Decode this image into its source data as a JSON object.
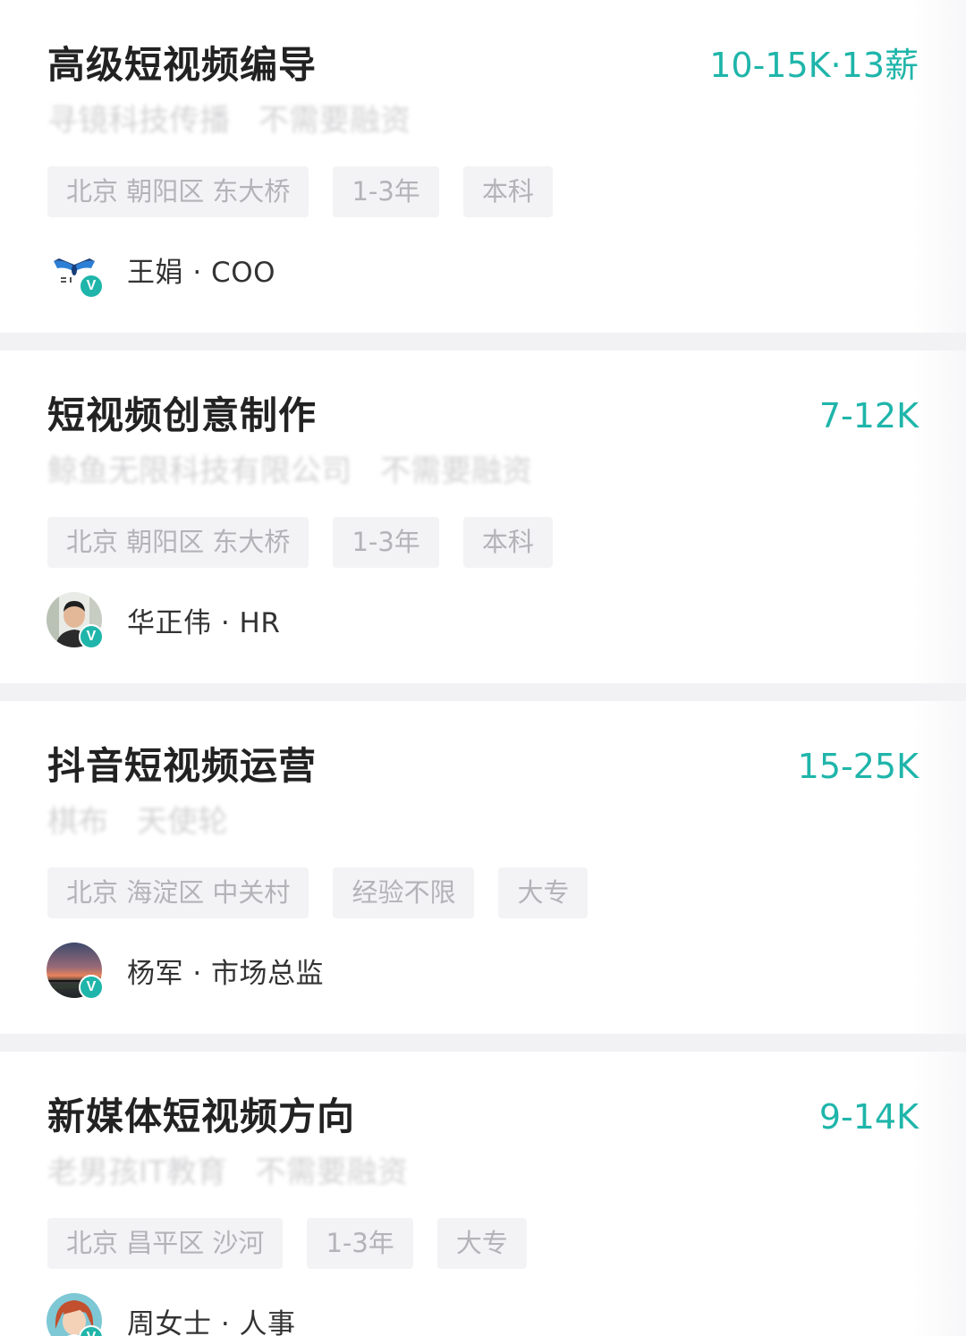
{
  "jobs": [
    {
      "title": "高级短视频编导",
      "salary": "10-15K·13薪",
      "company": "寻镜科技传播",
      "funding": "不需要融资",
      "tags": [
        "北京 朝阳区 东大桥",
        "1-3年",
        "本科"
      ],
      "recruiter": "王娟 · COO",
      "avatar_icon": "company-logo-icon",
      "verified_mark": "V"
    },
    {
      "title": "短视频创意制作",
      "salary": "7-12K",
      "company": "鲸鱼无限科技有限公司",
      "funding": "不需要融资",
      "tags": [
        "北京 朝阳区 东大桥",
        "1-3年",
        "本科"
      ],
      "recruiter": "华正伟 · HR",
      "avatar_icon": "person-photo-icon",
      "verified_mark": "V"
    },
    {
      "title": "抖音短视频运营",
      "salary": "15-25K",
      "company": "棋布",
      "funding": "天使轮",
      "tags": [
        "北京 海淀区 中关村",
        "经验不限",
        "大专"
      ],
      "recruiter": "杨军 · 市场总监",
      "avatar_icon": "sunset-photo-icon",
      "verified_mark": "V"
    },
    {
      "title": "新媒体短视频方向",
      "salary": "9-14K",
      "company": "老男孩IT教育",
      "funding": "不需要融资",
      "tags": [
        "北京 昌平区 沙河",
        "1-3年",
        "大专"
      ],
      "recruiter": "周女士 · 人事",
      "avatar_icon": "cartoon-woman-icon",
      "verified_mark": "V"
    }
  ],
  "colors": {
    "accent": "#1fb5aa",
    "title": "#222222",
    "tag_bg": "#f3f3f5",
    "tag_text": "#b3b3b8",
    "page_bg": "#f2f2f4"
  }
}
